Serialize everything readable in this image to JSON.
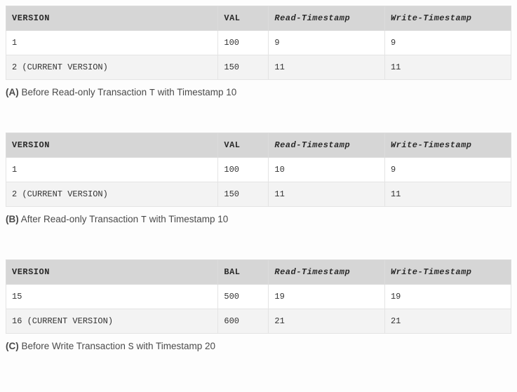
{
  "sections": [
    {
      "label": "(A)",
      "caption_prefix": "Before Read-only Transaction ",
      "txn": "T",
      "caption_suffix": " with Timestamp 10",
      "columns": {
        "version": "VERSION",
        "val": "VAL",
        "rt": "Read-Timestamp",
        "wt": "Write-Timestamp"
      },
      "rows": [
        {
          "version": "1",
          "val": "100",
          "rt": "9",
          "wt": "9"
        },
        {
          "version": "2 (CURRENT VERSION)",
          "val": "150",
          "rt": "11",
          "wt": "11"
        }
      ]
    },
    {
      "label": "(B)",
      "caption_prefix": "After Read-only Transaction ",
      "txn": "T",
      "caption_suffix": " with Timestamp 10",
      "columns": {
        "version": "VERSION",
        "val": "VAL",
        "rt": "Read-Timestamp",
        "wt": "Write-Timestamp"
      },
      "rows": [
        {
          "version": "1",
          "val": "100",
          "rt": "10",
          "wt": "9"
        },
        {
          "version": "2 (CURRENT VERSION)",
          "val": "150",
          "rt": "11",
          "wt": "11"
        }
      ]
    },
    {
      "label": "(C)",
      "caption_prefix": "Before Write Transaction ",
      "txn": "S",
      "caption_suffix": " with Timestamp 20",
      "columns": {
        "version": "VERSION",
        "val": "BAL",
        "rt": "Read-Timestamp",
        "wt": "Write-Timestamp"
      },
      "rows": [
        {
          "version": "15",
          "val": "500",
          "rt": "19",
          "wt": "19"
        },
        {
          "version": "16 (CURRENT VERSION)",
          "val": "600",
          "rt": "21",
          "wt": "21"
        }
      ]
    }
  ]
}
